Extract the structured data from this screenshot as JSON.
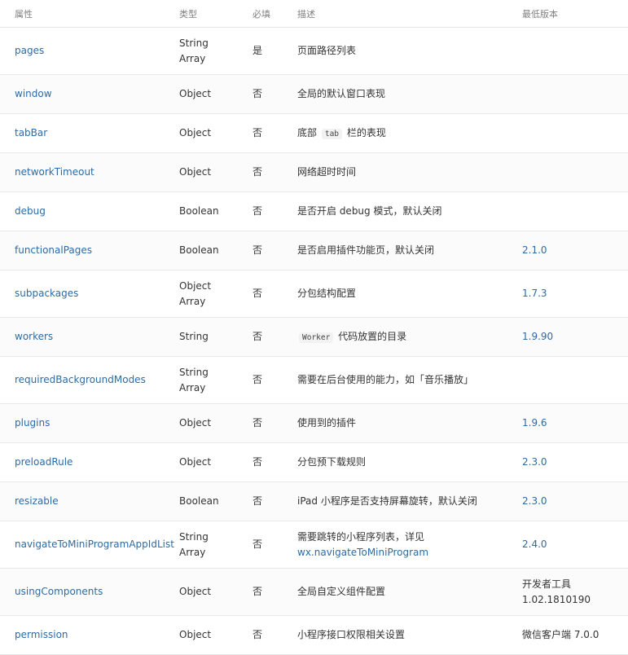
{
  "headers": [
    "属性",
    "类型",
    "必填",
    "描述",
    "最低版本"
  ],
  "rows": [
    {
      "name": "pages",
      "type": [
        "String",
        "Array"
      ],
      "required": "是",
      "desc": [
        "页面路径列表"
      ],
      "version": []
    },
    {
      "name": "window",
      "type": [
        "Object"
      ],
      "required": "否",
      "desc": [
        "全局的默认窗口表现"
      ],
      "version": []
    },
    {
      "name": "tabBar",
      "type": [
        "Object"
      ],
      "required": "否",
      "desc_parts": [
        "底部",
        "tab",
        "栏的表现"
      ],
      "version": []
    },
    {
      "name": "networkTimeout",
      "type": [
        "Object"
      ],
      "required": "否",
      "desc": [
        "网络超时时间"
      ],
      "version": []
    },
    {
      "name": "debug",
      "type": [
        "Boolean"
      ],
      "required": "否",
      "desc": [
        "是否开启 debug 模式，默认关闭"
      ],
      "version": []
    },
    {
      "name": "functionalPages",
      "type": [
        "Boolean"
      ],
      "required": "否",
      "desc": [
        "是否启用插件功能页，默认关闭"
      ],
      "version": [
        "2.1.0"
      ]
    },
    {
      "name": "subpackages",
      "type": [
        "Object",
        "Array"
      ],
      "required": "否",
      "desc": [
        "分包结构配置"
      ],
      "version": [
        "1.7.3"
      ]
    },
    {
      "name": "workers",
      "type": [
        "String"
      ],
      "required": "否",
      "desc_parts": [
        "",
        "Worker",
        "代码放置的目录"
      ],
      "version": [
        "1.9.90"
      ]
    },
    {
      "name": "requiredBackgroundModes",
      "type": [
        "String",
        "Array"
      ],
      "required": "否",
      "desc": [
        "需要在后台使用的能力，如「音乐播放」"
      ],
      "version": []
    },
    {
      "name": "plugins",
      "type": [
        "Object"
      ],
      "required": "否",
      "desc": [
        "使用到的插件"
      ],
      "version": [
        "1.9.6"
      ]
    },
    {
      "name": "preloadRule",
      "type": [
        "Object"
      ],
      "required": "否",
      "desc": [
        "分包预下载规则"
      ],
      "version": [
        "2.3.0"
      ]
    },
    {
      "name": "resizable",
      "type": [
        "Boolean"
      ],
      "required": "否",
      "desc": [
        "iPad 小程序是否支持屏幕旋转，默认关闭"
      ],
      "version": [
        "2.3.0"
      ]
    },
    {
      "name": "navigateToMiniProgramAppIdList",
      "type": [
        "String",
        "Array"
      ],
      "required": "否",
      "desc": [
        "需要跳转的小程序列表，详见"
      ],
      "desc_link": "wx.navigateToMiniProgram",
      "version": [
        "2.4.0"
      ]
    },
    {
      "name": "usingComponents",
      "type": [
        "Object"
      ],
      "required": "否",
      "desc": [
        "全局自定义组件配置"
      ],
      "version": [
        "开发者工具",
        "1.02.1810190"
      ],
      "version_plain": true
    },
    {
      "name": "permission",
      "type": [
        "Object"
      ],
      "required": "否",
      "desc": [
        "小程序接口权限相关设置"
      ],
      "version": [
        "微信客户端 7.0.0"
      ],
      "version_plain": true
    }
  ],
  "colors": {
    "link": "#2b6ba8",
    "header": "#7f7f7f",
    "text": "#333333"
  }
}
